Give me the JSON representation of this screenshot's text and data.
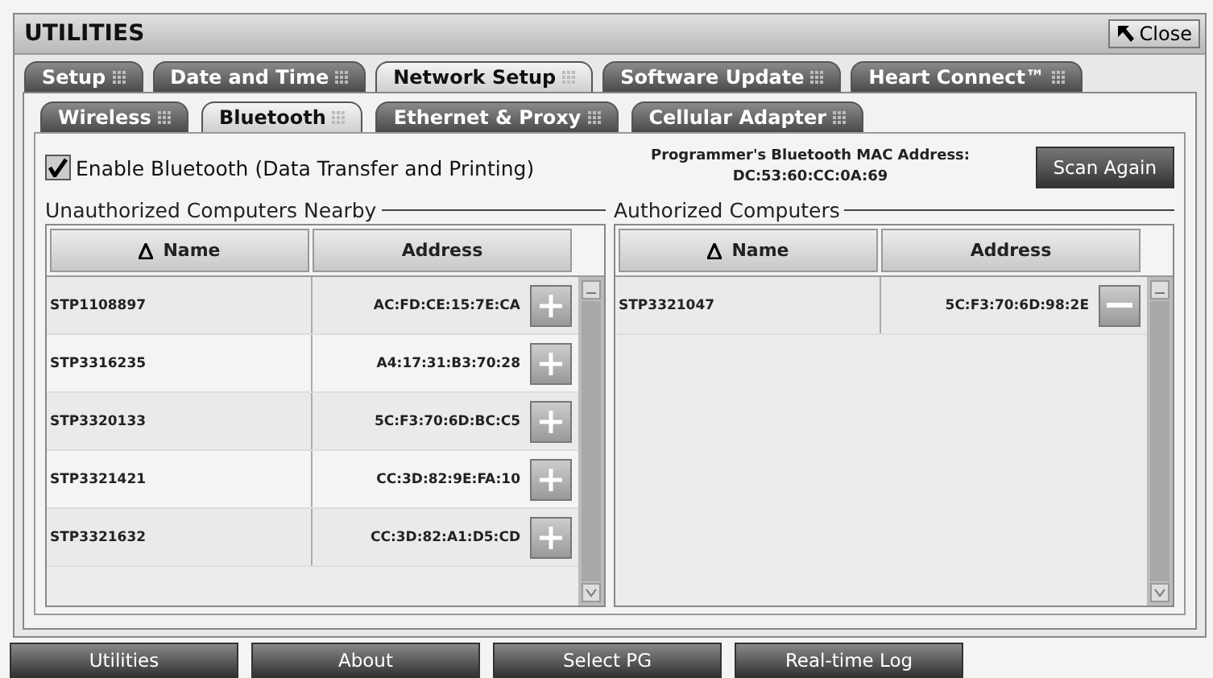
{
  "window": {
    "title": "UTILITIES",
    "close": "Close"
  },
  "tabs": [
    {
      "label": "Setup",
      "selected": false
    },
    {
      "label": "Date and Time",
      "selected": false
    },
    {
      "label": "Network Setup",
      "selected": true
    },
    {
      "label": "Software Update",
      "selected": false
    },
    {
      "label": "Heart Connect™",
      "selected": false
    }
  ],
  "subtabs": [
    {
      "label": "Wireless",
      "selected": false
    },
    {
      "label": "Bluetooth",
      "selected": true
    },
    {
      "label": "Ethernet & Proxy",
      "selected": false
    },
    {
      "label": "Cellular Adapter",
      "selected": false
    }
  ],
  "enable_bluetooth": {
    "label": "Enable Bluetooth (Data Transfer and Printing)",
    "checked": true
  },
  "mac_address": {
    "label": "Programmer's Bluetooth MAC Address:",
    "value": "DC:53:60:CC:0A:69"
  },
  "scan_button": "Scan Again",
  "lists": [
    {
      "title": "Unauthorized Computers Nearby",
      "kind": "add",
      "columns": [
        "Name",
        "Address"
      ],
      "rows": [
        {
          "name": "STP1108897",
          "address": "AC:FD:CE:15:7E:CA"
        },
        {
          "name": "STP3316235",
          "address": "A4:17:31:B3:70:28"
        },
        {
          "name": "STP3320133",
          "address": "5C:F3:70:6D:BC:C5"
        },
        {
          "name": "STP3321421",
          "address": "CC:3D:82:9E:FA:10"
        },
        {
          "name": "STP3321632",
          "address": "CC:3D:82:A1:D5:CD"
        }
      ]
    },
    {
      "title": "Authorized Computers",
      "kind": "remove",
      "columns": [
        "Name",
        "Address"
      ],
      "rows": [
        {
          "name": "STP3321047",
          "address": "5C:F3:70:6D:98:2E"
        }
      ]
    }
  ],
  "bottom_buttons": [
    "Utilities",
    "About",
    "Select PG",
    "Real-time Log"
  ]
}
